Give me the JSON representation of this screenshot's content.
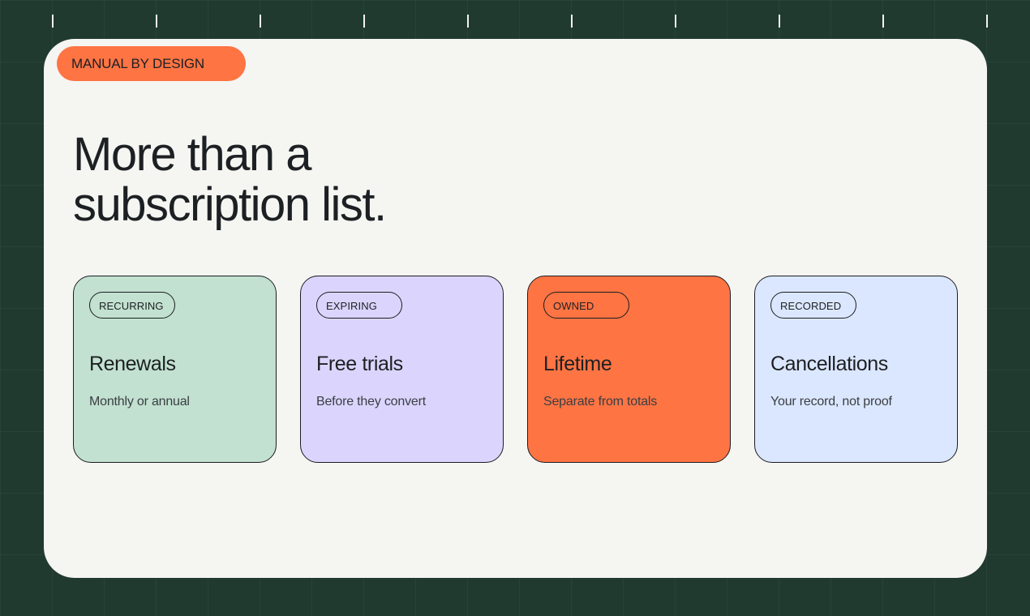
{
  "colors": {
    "background": "#203a2f",
    "panel": "#f5f5f2",
    "accent": "#fe7443",
    "text": "#1d2023"
  },
  "badge": {
    "label": "MANUAL BY DESIGN"
  },
  "headline": {
    "line1": "More than a",
    "line2": "subscription list."
  },
  "cards": [
    {
      "tag": "RECURRING",
      "title": "Renewals",
      "subtitle": "Monthly or annual",
      "color": "#c2e1d0"
    },
    {
      "tag": "EXPIRING",
      "title": "Free trials",
      "subtitle": "Before they convert",
      "color": "#dbd5fd"
    },
    {
      "tag": "OWNED",
      "title": "Lifetime",
      "subtitle": "Separate from totals",
      "color": "#fe7443"
    },
    {
      "tag": "RECORDED",
      "title": "Cancellations",
      "subtitle": "Your record, not proof",
      "color": "#dbe7fe"
    }
  ]
}
